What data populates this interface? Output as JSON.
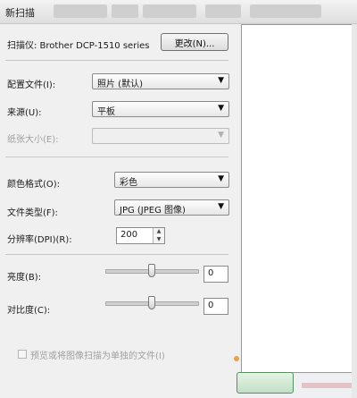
{
  "window": {
    "title": "新扫描"
  },
  "scanner": {
    "label": "扫描仪: Brother DCP-1510 series",
    "change_button": "更改(N)..."
  },
  "profile": {
    "label": "配置文件(I):",
    "value": "照片 (默认)"
  },
  "source": {
    "label": "来源(U):",
    "value": "平板"
  },
  "paper_size": {
    "label": "纸张大小(E):",
    "value": ""
  },
  "color_format": {
    "label": "颜色格式(O):",
    "value": "彩色"
  },
  "file_type": {
    "label": "文件类型(F):",
    "value": "JPG (JPEG 图像)"
  },
  "resolution": {
    "label": "分辨率(DPI)(R):",
    "value": "200"
  },
  "brightness": {
    "label": "亮度(B):",
    "value": "0"
  },
  "contrast": {
    "label": "对比度(C):",
    "value": "0"
  },
  "checkbox": {
    "label": "预览或将图像扫描为单独的文件(I)",
    "checked": false
  },
  "icons": {
    "dropdown": "▼",
    "spin_up": "▲",
    "spin_down": "▼"
  },
  "colors": {
    "panel": "#f0f0f0",
    "preview_bg": "#ffffff",
    "accent_button": "#c2dfc6"
  }
}
